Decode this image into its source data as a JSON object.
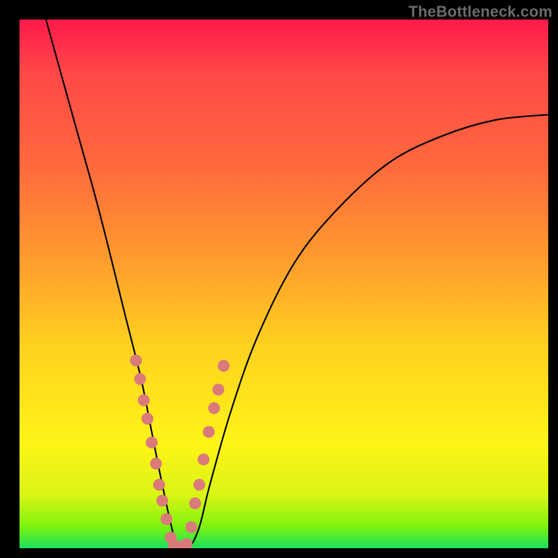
{
  "watermark": "TheBottleneck.com",
  "colors": {
    "gradient_top": "#ff1a4b",
    "gradient_mid_upper": "#ff6a3c",
    "gradient_mid": "#ffd21f",
    "gradient_mid_lower": "#fff417",
    "gradient_bottom": "#18e060",
    "frame": "#000000",
    "curve": "#000000",
    "dots": "#db7a7a"
  },
  "chart_data": {
    "type": "line",
    "title": "",
    "xlabel": "",
    "ylabel": "",
    "xlim": [
      0,
      100
    ],
    "ylim": [
      0,
      100
    ],
    "series": [
      {
        "name": "bottleneck-curve",
        "x": [
          5,
          10,
          15,
          20,
          23,
          25,
          27,
          29,
          30,
          32,
          34,
          36,
          40,
          45,
          52,
          60,
          70,
          80,
          90,
          100
        ],
        "y": [
          100,
          82,
          64,
          44,
          32,
          22,
          12,
          3,
          0,
          0,
          4,
          12,
          26,
          40,
          54,
          64,
          73,
          78,
          81,
          82
        ]
      }
    ],
    "markers": {
      "name": "data-points",
      "x": [
        22.0,
        22.8,
        23.5,
        24.2,
        25.0,
        25.8,
        26.4,
        27.0,
        27.8,
        28.6,
        29.2,
        30.0,
        30.8,
        31.6,
        32.5,
        33.2,
        34.0,
        34.8,
        35.8,
        36.8,
        37.6,
        38.6
      ],
      "y": [
        35.5,
        32.0,
        28.0,
        24.5,
        20.0,
        16.0,
        12.0,
        9.0,
        5.5,
        2.0,
        0.5,
        0.3,
        0.3,
        0.8,
        4.0,
        8.5,
        12.0,
        16.8,
        22.0,
        26.5,
        30.0,
        34.5
      ]
    },
    "legend": [],
    "grid": false
  }
}
